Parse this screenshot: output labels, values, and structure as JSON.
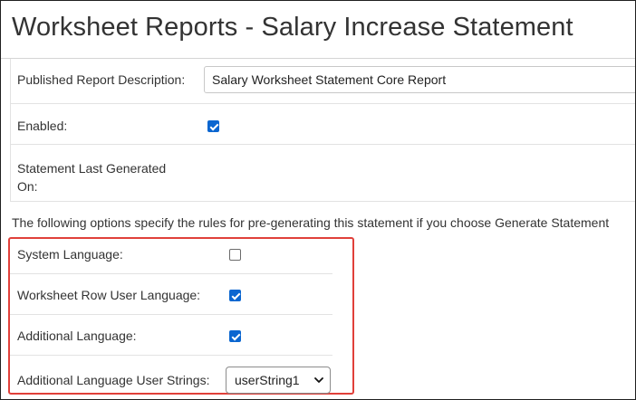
{
  "page": {
    "title": "Worksheet Reports - Salary Increase Statement"
  },
  "fields": {
    "published_report_description": {
      "label": "Published Report Description:",
      "value": "Salary Worksheet Statement Core Report"
    },
    "enabled": {
      "label": "Enabled:",
      "checked": true
    },
    "statement_last_generated": {
      "label_line1": "Statement Last Generated",
      "label_line2": "On:",
      "value": ""
    }
  },
  "pregenerate": {
    "info_text": "The following options specify the rules for pre-generating this statement if you choose Generate Statement",
    "system_language": {
      "label": "System Language:",
      "checked": false
    },
    "worksheet_row_user_language": {
      "label": "Worksheet Row User Language:",
      "checked": true
    },
    "additional_language": {
      "label": "Additional Language:",
      "checked": true
    },
    "additional_language_user_strings": {
      "label": "Additional Language User Strings:",
      "selected": "userString1"
    }
  },
  "colors": {
    "highlight": "#e0403a",
    "checkbox_checked": "#0b66d0"
  }
}
